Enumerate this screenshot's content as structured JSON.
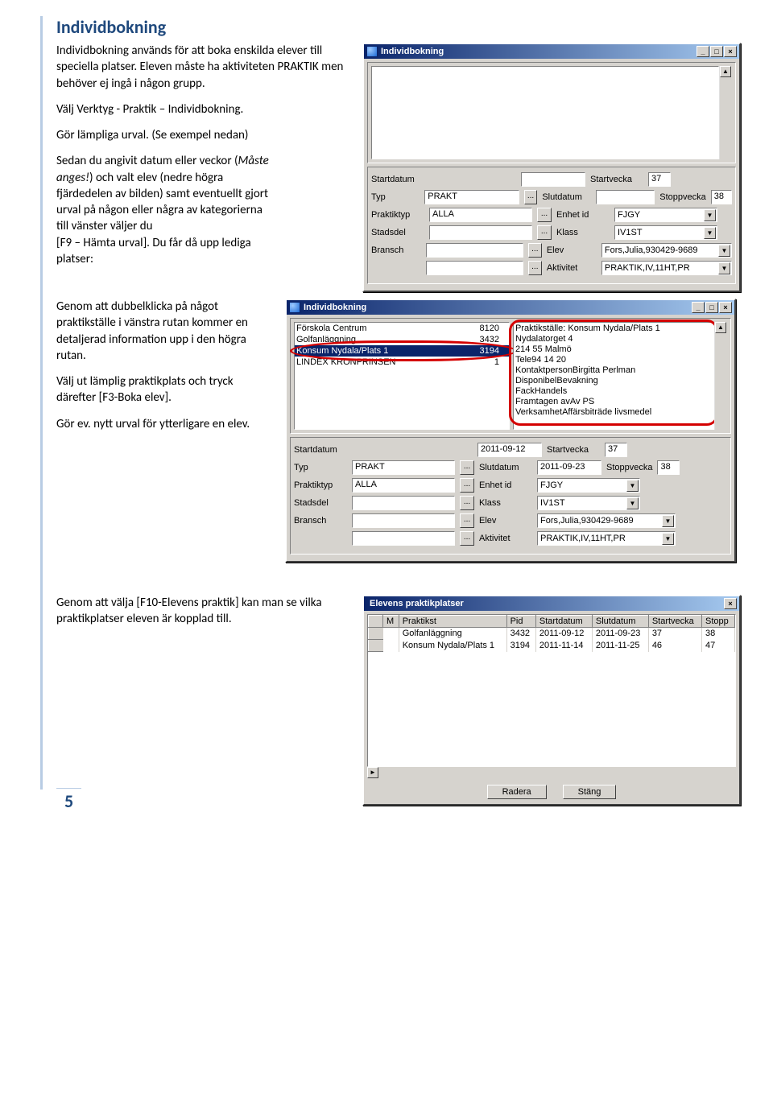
{
  "doc": {
    "title": "Individbokning",
    "p1": "Individbokning används för att boka enskilda elever till speciella platser. Eleven måste ha aktiviteten PRAKTIK men behöver ej ingå i någon grupp.",
    "p2": "Välj Verktyg - Praktik – Individbokning.",
    "p3": "Gör lämpliga urval. (Se exempel nedan)",
    "p4a": "Sedan du angivit datum eller veckor (",
    "p4b": "Måste anges!",
    "p4c": ") och valt elev (nedre högra fjärdedelen av bilden) samt eventuellt gjort urval på någon eller några av kategorierna till vänster väljer du",
    "p4d": "[F9 – Hämta urval]. Du får då upp lediga platser:",
    "p5": "Genom att dubbelklicka på något praktikställe i vänstra rutan kommer en detaljerad information upp i den högra rutan.",
    "p6": "Välj ut lämplig praktikplats och tryck därefter [F3-Boka elev].",
    "p7": "Gör ev. nytt urval för ytterligare en elev.",
    "p8": "Genom att välja [F10-Elevens praktik] kan man se vilka praktikplatser eleven är kopplad till.",
    "page_num": "5"
  },
  "win1": {
    "title": "Individbokning",
    "labels": {
      "typ": "Typ",
      "praktiktyp": "Praktiktyp",
      "stadsdel": "Stadsdel",
      "bransch": "Bransch",
      "startdatum": "Startdatum",
      "slutdatum": "Slutdatum",
      "startvecka": "Startvecka",
      "stoppvecka": "Stoppvecka",
      "enhetid": "Enhet id",
      "klass": "Klass",
      "elev": "Elev",
      "aktivitet": "Aktivitet"
    },
    "values": {
      "typ": "PRAKT",
      "praktiktyp": "ALLA",
      "stadsdel": "",
      "bransch": "",
      "startdatum": "",
      "slutdatum": "",
      "startvecka": "37",
      "stoppvecka": "38",
      "enhetid": "FJGY",
      "klass": "IV1ST",
      "elev": "Fors,Julia,930429-9689",
      "aktivitet": "PRAKTIK,IV,11HT,PR"
    }
  },
  "win2": {
    "title": "Individbokning",
    "list": [
      {
        "name": "Förskola Centrum",
        "id": "8120"
      },
      {
        "name": "Golfanläggning",
        "id": "3432"
      },
      {
        "name": "Konsum Nydala/Plats 1",
        "id": "3194"
      },
      {
        "name": "LINDEX KRONPRINSEN",
        "id": "1"
      }
    ],
    "selected_index": 2,
    "info": [
      "Praktikställe: Konsum Nydala/Plats 1",
      "Nydalatorget 4",
      "214 55 Malmö",
      "Tele94 14 20",
      "KontaktpersonBirgitta Perlman",
      "DisponibelBevakning",
      "FackHandels",
      "Framtagen avAv PS",
      "VerksamhetAffärsbiträde livsmedel"
    ],
    "form": {
      "startdatum": "2011-09-12",
      "slutdatum": "2011-09-23",
      "startvecka": "37",
      "stoppvecka": "38",
      "typ": "PRAKT",
      "praktiktyp": "ALLA",
      "stadsdel": "",
      "bransch": "",
      "enhetid": "FJGY",
      "klass": "IV1ST",
      "elev": "Fors,Julia,930429-9689",
      "aktivitet": "PRAKTIK,IV,11HT,PR"
    }
  },
  "win3": {
    "title": "Elevens praktikplatser",
    "headers": [
      "M",
      "Praktikst",
      "Pid",
      "Startdatum",
      "Slutdatum",
      "Startvecka",
      "Stopp"
    ],
    "rows": [
      [
        "",
        "Golfanläggning",
        "3432",
        "2011-09-12",
        "2011-09-23",
        "37",
        "38"
      ],
      [
        "",
        "Konsum Nydala/Plats 1",
        "3194",
        "2011-11-14",
        "2011-11-25",
        "46",
        "47"
      ]
    ],
    "btn_radera": "Radera",
    "btn_stang": "Stäng"
  },
  "glyphs": {
    "min": "_",
    "max": "□",
    "close": "×",
    "down": "▼",
    "up": "▲",
    "left": "◄",
    "right": "►",
    "dots": "..."
  }
}
